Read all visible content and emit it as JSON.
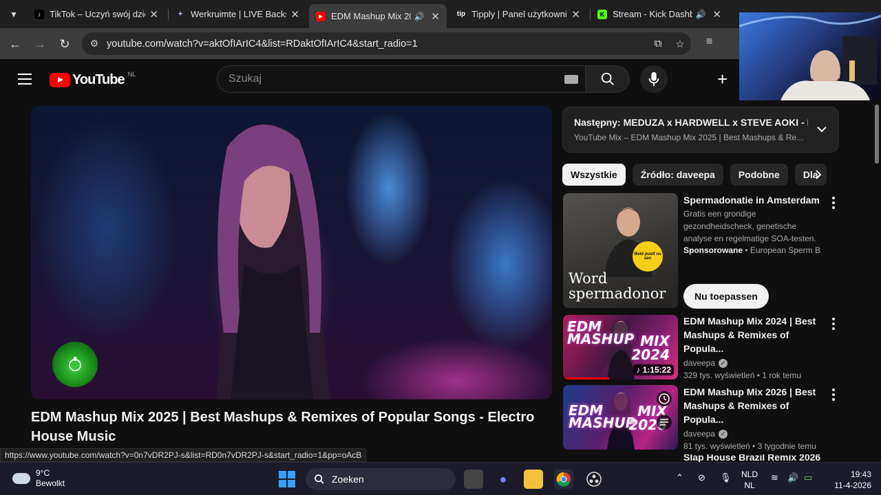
{
  "browser": {
    "tabs": [
      {
        "title": "TikTok – Uczyń swój dzień",
        "favicon": "tiktok-icon",
        "active": false,
        "audio": false
      },
      {
        "title": "Werkruimte | LIVE Backstage",
        "favicon": "werkruimte-icon",
        "active": false,
        "audio": false
      },
      {
        "title": "EDM Mashup Mix 2025",
        "favicon": "youtube-icon",
        "active": true,
        "audio": true
      },
      {
        "title": "Tipply | Panel użytkownika",
        "favicon": "tipply-icon",
        "active": false,
        "audio": false
      },
      {
        "title": "Stream - Kick Dashboard",
        "favicon": "kick-icon",
        "active": false,
        "audio": true
      }
    ],
    "url": "youtube.com/watch?v=aktOfIArIC4&list=RDaktOfIArIC4&start_radio=1",
    "status_url": "https://www.youtube.com/watch?v=0n7vDR2PJ-s&list=RD0n7vDR2PJ-s&start_radio=1&pp=oAcB"
  },
  "youtube": {
    "logo_text": "YouTube",
    "region": "NL",
    "search_placeholder": "Szukaj",
    "video_title": "EDM Mashup Mix 2025 | Best Mashups & Remixes of Popular Songs - Electro House Music",
    "up_next": {
      "label": "Następny: MEDUZA x HARDWELL x STEVE AOKI - F...",
      "playlist": "YouTube Mix – EDM Mashup Mix 2025 | Best Mashups & Re..."
    },
    "chips": [
      "Wszystkie",
      "Źródło: daveepa",
      "Podobne",
      "Dla"
    ],
    "ad": {
      "title": "Spermadonatie in Amsterdam",
      "description": "Gratis een grondige gezondheidscheck, genetische analyse en regelmatige SOA-testen.",
      "sponsored_label": "Sponsorowane",
      "advertiser": "European Sperm B...",
      "cta": "Nu toepassen",
      "thumb_text": "Word spermadonor",
      "thumb_badge": "Meld jezelf nu aan"
    },
    "videos": [
      {
        "title": "EDM Mashup Mix 2024 | Best Mashups & Remixes of Popula...",
        "channel": "daveepa",
        "meta": "329 tys. wyświetleń • 1 rok temu",
        "duration": "1:15:22",
        "thumb_left": "EDM\nMASHUP",
        "thumb_right": "MIX\n2024",
        "progress": 0.4
      },
      {
        "title": "EDM Mashup Mix 2026 | Best Mashups & Remixes of Popula...",
        "channel": "daveepa",
        "meta": "81 tys. wyświetleń • 3 tygodnie temu",
        "duration": "",
        "thumb_left": "EDM\nMASHUP",
        "thumb_right": "MIX\n2026",
        "progress": 0
      }
    ],
    "next_partial_title": "Slap House Brazil Remix 2026"
  },
  "taskbar": {
    "temperature": "9°C",
    "weather": "Bewolkt",
    "search_label": "Zoeken",
    "language": "NLD",
    "keyboard": "NL",
    "time": "19:43",
    "date": "11-4-2026"
  }
}
